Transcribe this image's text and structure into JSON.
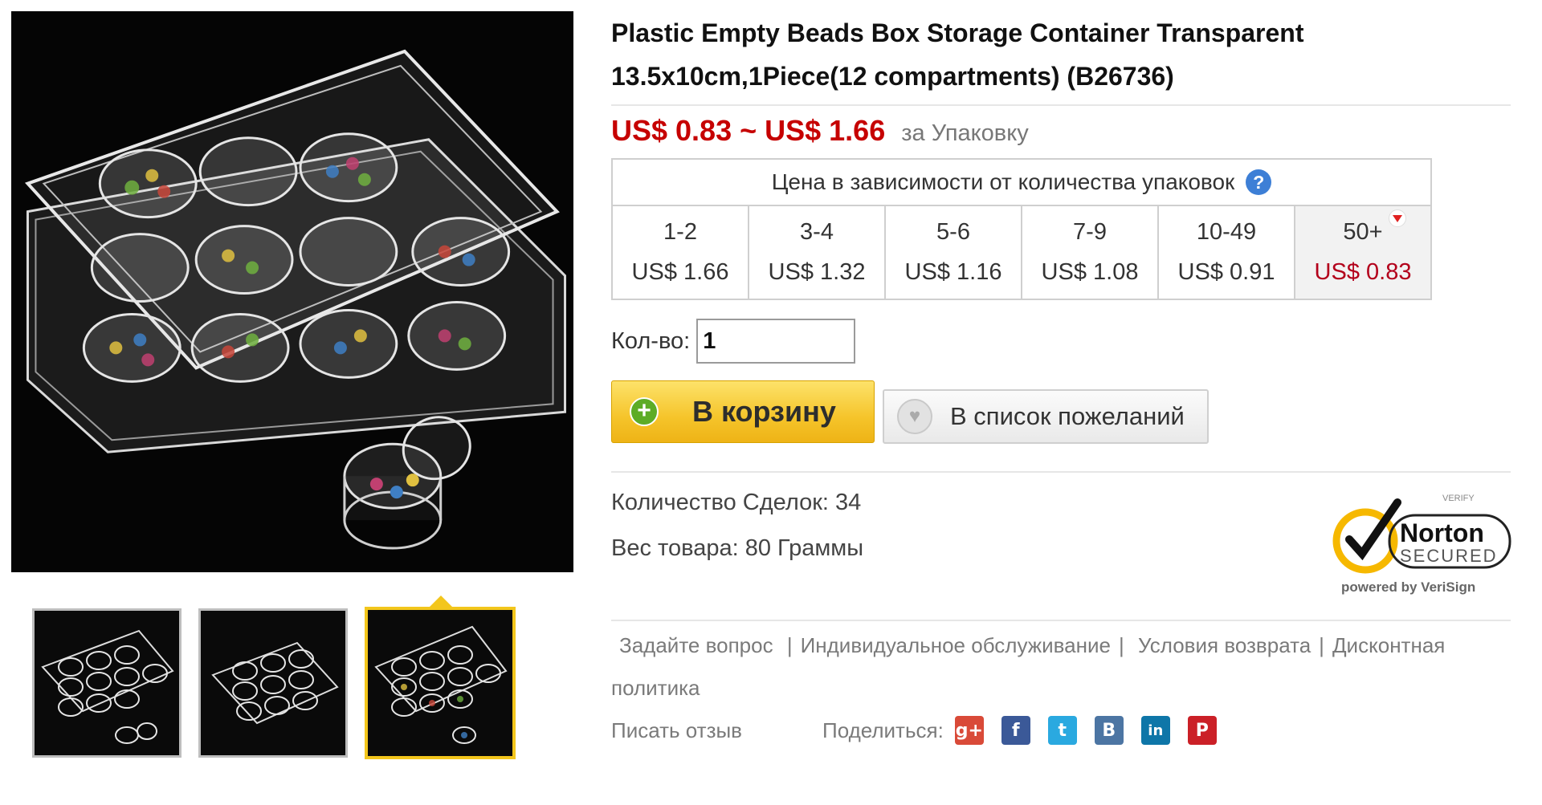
{
  "product": {
    "title_line1": "Plastic Empty Beads Box Storage Container Transparent",
    "title_line2": "13.5x10cm,1Piece(12 compartments)  (B26736)",
    "price_range": "US$ 0.83 ~ US$ 1.66",
    "price_unit": "за Упаковку"
  },
  "tiers": {
    "header": "Цена в зависимости от количества упаковок",
    "help_icon": "question-icon",
    "columns": [
      {
        "qty": "1-2",
        "price": "US$ 1.66"
      },
      {
        "qty": "3-4",
        "price": "US$ 1.32"
      },
      {
        "qty": "5-6",
        "price": "US$ 1.16"
      },
      {
        "qty": "7-9",
        "price": "US$ 1.08"
      },
      {
        "qty": "10-49",
        "price": "US$ 0.91"
      },
      {
        "qty": "50+",
        "price": "US$ 0.83"
      }
    ]
  },
  "quantity": {
    "label": "Кол-во:",
    "value": "1"
  },
  "buttons": {
    "cart": "В корзину",
    "wishlist": "В список пожеланий"
  },
  "details": {
    "deals": "Количество Сделок: 34",
    "weight": "Вес товара: 80 Граммы"
  },
  "norton": {
    "verify": "VERIFY",
    "name": "Norton",
    "secured": "SECURED",
    "powered": "powered by VeriSign"
  },
  "links": {
    "ask": "Задайте вопрос",
    "service": "Индивидуальное обслуживание",
    "returns": "Условия возврата",
    "discount": "Дисконтная политика",
    "review": "Писать отзыв",
    "share": "Поделиться:"
  },
  "social": [
    {
      "name": "google-plus",
      "glyph": "g+",
      "color": "#d94a38"
    },
    {
      "name": "facebook",
      "glyph": "f",
      "color": "#3b5998"
    },
    {
      "name": "twitter",
      "glyph": "t",
      "color": "#2aa9e0"
    },
    {
      "name": "vkontakte",
      "glyph": "B",
      "color": "#4c75a3"
    },
    {
      "name": "linkedin",
      "glyph": "in",
      "color": "#0e76a8"
    },
    {
      "name": "pinterest",
      "glyph": "P",
      "color": "#cb2027"
    }
  ],
  "colors": {
    "price": "#c60000",
    "accent": "#f3c61c",
    "cart_button": "#f5c42a"
  }
}
